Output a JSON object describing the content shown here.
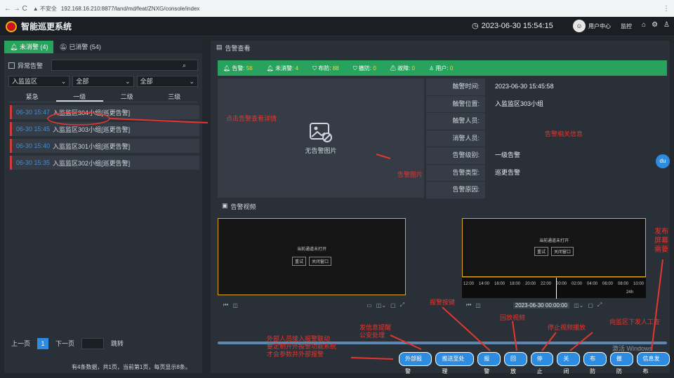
{
  "browser": {
    "nav": "←  →  C",
    "warning": "▲ 不安全",
    "url": "192.168.16.210:8877/land/md/feat/ZNXG/console/index"
  },
  "app": {
    "title": "智能巡更系统",
    "datetime": "2023-06-30 15:54:15",
    "username": "用户中心",
    "role": "监控"
  },
  "left": {
    "tabs": [
      {
        "label": "未消警 (4)"
      },
      {
        "label": "已消警 (54)"
      }
    ],
    "abnormal_label": "异常告警",
    "filters": [
      "入监监区",
      "全部",
      "全部"
    ],
    "levels": [
      "紧急",
      "一级",
      "二级",
      "三级"
    ],
    "alarms": [
      {
        "time": "06-30 15:47",
        "text": "入监监区304小组[巡更告警]"
      },
      {
        "time": "06-30 15:45",
        "text": "入监监区303小组[巡更告警]"
      },
      {
        "time": "06-30 15:40",
        "text": "入监监区301小组[巡更告警]"
      },
      {
        "time": "06-30 15:35",
        "text": "入监监区302小组[巡更告警]"
      }
    ],
    "pager": {
      "prev": "上一页",
      "page": "1",
      "next": "下一页",
      "jump": "跳转",
      "info": "有4条数据，共1页，当前第1页，每页显示8条。"
    }
  },
  "right": {
    "header": "告警查看",
    "stats": [
      {
        "label": "告警:",
        "value": "56"
      },
      {
        "label": "未消警:",
        "value": "4"
      },
      {
        "label": "布防:",
        "value": "88"
      },
      {
        "label": "撤防:",
        "value": "0"
      },
      {
        "label": "故障:",
        "value": "0"
      },
      {
        "label": "用户:",
        "value": "0"
      }
    ],
    "no_image": "无告警图片",
    "info": [
      {
        "label": "触警时间:",
        "value": "2023-06-30 15:45:58"
      },
      {
        "label": "触警位置:",
        "value": "入监监区303小组"
      },
      {
        "label": "触警人员:",
        "value": ""
      },
      {
        "label": "消警人员:",
        "value": ""
      },
      {
        "label": "告警级别:",
        "value": "一级告警"
      },
      {
        "label": "告警类型:",
        "value": "巡更告警"
      },
      {
        "label": "告警原因:",
        "value": ""
      }
    ],
    "video_header": "告警视频",
    "video1": {
      "msg": "当前通道未打开",
      "retry": "重试",
      "close": "关闭窗口"
    },
    "video2": {
      "msg": "当前通道未打开",
      "retry": "重试",
      "close": "关闭窗口"
    },
    "timeline_times": [
      "12:00",
      "14:00",
      "16:00",
      "18:00",
      "20:00",
      "22:00",
      "00:00",
      "02:00",
      "04:00",
      "06:00",
      "08:00",
      "10:00"
    ],
    "timeline_date": "2023-06-30 00:00:00",
    "zoom": "24h",
    "buttons": [
      "外部报警",
      "推送至处理",
      "报警",
      "回放",
      "停止",
      "关闭",
      "布防",
      "撤防",
      "信息发布"
    ]
  },
  "annotations": {
    "a1": "点击告警查看详情",
    "a2": "告警相关信息",
    "a3": "告警图片",
    "a4": "报警按键",
    "a5": "发信息提醒\n公安处理",
    "a6": "回放视频",
    "a7": "停止视频播放",
    "a8": "向监区下发人工查",
    "a9": "发布\n屏幕\n需要",
    "a10": "外部人员接入报警联动\n要定制开外报警功能系统\n才会参数并外部报警"
  },
  "watermark": "激活 Windows",
  "colors": {
    "accent": "#27a35d",
    "primary": "#2d8ce0",
    "alarm": "#d23b3b",
    "annotation": "#e6362f"
  }
}
